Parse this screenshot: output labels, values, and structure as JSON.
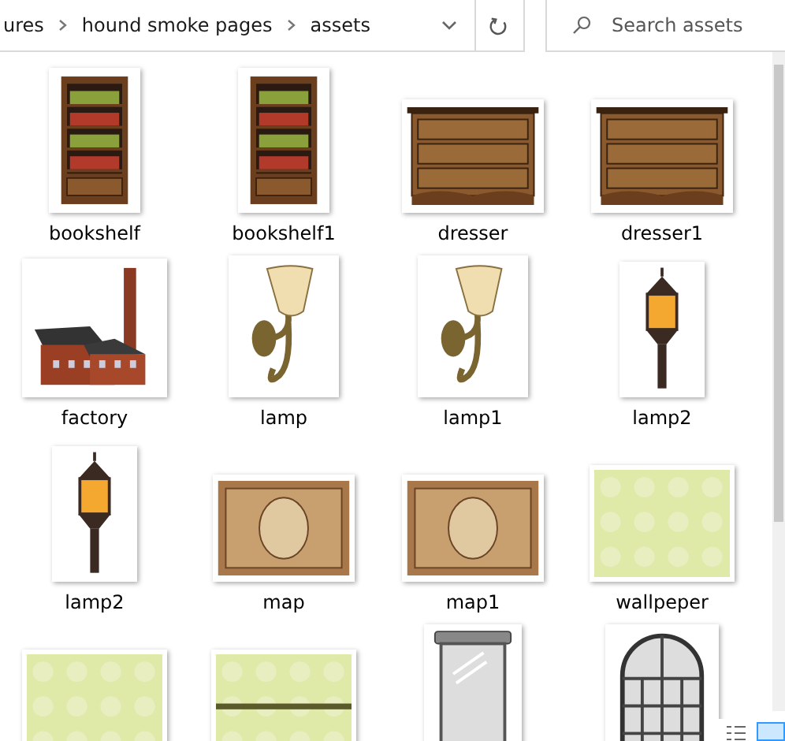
{
  "address_bar": {
    "segments": [
      {
        "label": "ures"
      },
      {
        "label": "hound smoke pages"
      },
      {
        "label": "assets"
      }
    ]
  },
  "search": {
    "placeholder": "Search assets"
  },
  "files": [
    {
      "kind": "bookshelf",
      "name": "bookshelf"
    },
    {
      "kind": "bookshelf",
      "name": "bookshelf1"
    },
    {
      "kind": "dresser",
      "name": "dresser"
    },
    {
      "kind": "dresser",
      "name": "dresser1"
    },
    {
      "kind": "factory",
      "name": "factory"
    },
    {
      "kind": "sconce",
      "name": "lamp"
    },
    {
      "kind": "sconce",
      "name": "lamp1"
    },
    {
      "kind": "lantern",
      "name": "lamp2"
    },
    {
      "kind": "lantern",
      "name": "lamp2"
    },
    {
      "kind": "map",
      "name": "map"
    },
    {
      "kind": "map",
      "name": "map1"
    },
    {
      "kind": "wallpaper",
      "name": "wallpeper"
    },
    {
      "kind": "wallpaper"
    },
    {
      "kind": "wallpaper-border"
    },
    {
      "kind": "mirror"
    },
    {
      "kind": "window"
    }
  ]
}
